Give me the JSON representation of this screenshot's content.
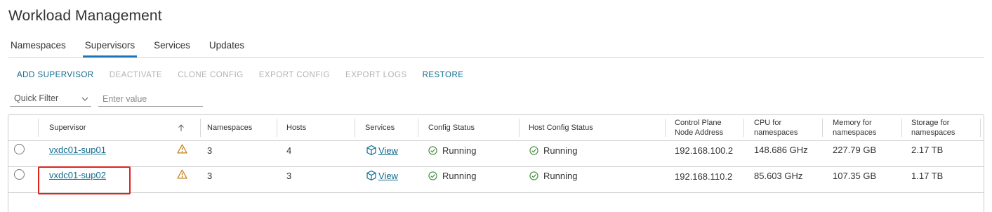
{
  "page": {
    "title": "Workload Management"
  },
  "tabs": [
    {
      "label": "Namespaces",
      "active": false
    },
    {
      "label": "Supervisors",
      "active": true
    },
    {
      "label": "Services",
      "active": false
    },
    {
      "label": "Updates",
      "active": false
    }
  ],
  "toolbar": {
    "add_supervisor": "ADD SUPERVISOR",
    "deactivate": "DEACTIVATE",
    "clone_config": "CLONE CONFIG",
    "export_config": "EXPORT CONFIG",
    "export_logs": "EXPORT LOGS",
    "restore": "RESTORE"
  },
  "filter": {
    "quick_filter": "Quick Filter",
    "placeholder": "Enter value"
  },
  "columns": {
    "supervisor": "Supervisor",
    "namespaces": "Namespaces",
    "hosts": "Hosts",
    "services": "Services",
    "config_status": "Config Status",
    "host_config_status": "Host Config Status",
    "control_plane_1": "Control Plane",
    "control_plane_2": "Node Address",
    "cpu_1": "CPU for",
    "cpu_2": "namespaces",
    "memory_1": "Memory for",
    "memory_2": "namespaces",
    "storage_1": "Storage for",
    "storage_2": "namespaces"
  },
  "rows": [
    {
      "supervisor": "vxdc01-sup01",
      "namespaces": "3",
      "hosts": "4",
      "services": "View",
      "config_status": "Running",
      "host_config_status": "Running",
      "control_plane": "192.168.100.2",
      "cpu": "148.686 GHz",
      "memory": "227.79 GB",
      "storage": "2.17 TB"
    },
    {
      "supervisor": "vxdc01-sup02",
      "namespaces": "3",
      "hosts": "3",
      "services": "View",
      "config_status": "Running",
      "host_config_status": "Running",
      "control_plane": "192.168.110.2",
      "cpu": "85.603 GHz",
      "memory": "107.35 GB",
      "storage": "1.17 TB"
    }
  ],
  "colors": {
    "accent": "#1b75bb",
    "link": "#0f6a8e",
    "running": "#3f8a3a",
    "warning": "#c27d12",
    "highlight": "#e0221c"
  }
}
